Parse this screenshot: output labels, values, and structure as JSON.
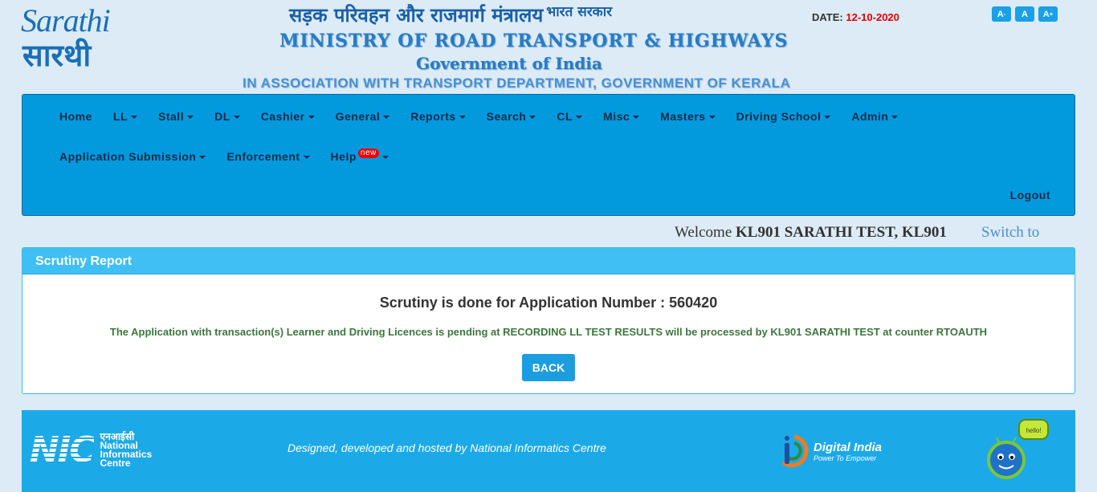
{
  "header": {
    "logo_top": "Sarathi",
    "logo_bottom": "सारथी",
    "hindi_title": "सड़क परिवहन और राजमार्ग मंत्रालय",
    "hindi_sub": "भारत सरकार",
    "title_en": "MINISTRY OF ROAD TRANSPORT & HIGHWAYS",
    "goi": "Government of India",
    "association": "IN ASSOCIATION WITH TRANSPORT DEPARTMENT, GOVERNMENT OF KERALA",
    "date_label": "DATE:",
    "date_value": "12-10-2020",
    "font_buttons": [
      "A",
      "A",
      "A"
    ]
  },
  "nav": {
    "row1": [
      "Home",
      "LL",
      "Stall",
      "DL",
      "Cashier",
      "General",
      "Reports",
      "Search",
      "CL",
      "Misc",
      "Masters",
      "Driving School",
      "Admin"
    ],
    "row2": [
      "Application Submission",
      "Enforcement",
      "Help"
    ],
    "new_badge": "new",
    "logout": "Logout"
  },
  "welcome": {
    "prefix": "Welcome",
    "user": "KL901 SARATHI TEST, KL901",
    "switch": "Switch to"
  },
  "panel": {
    "title": "Scrutiny Report",
    "heading": "Scrutiny is done for Application Number : 560420",
    "message": "The Application with transaction(s) Learner and Driving Licences is pending at RECORDING LL TEST RESULTS will be processed by KL901 SARATHI TEST at counter RTOAUTH",
    "back_label": "BACK"
  },
  "footer": {
    "nic_logo": "NIC",
    "nic_hindi": "एनआईसी",
    "nic_line1": "National",
    "nic_line2": "Informatics",
    "nic_line3": "Centre",
    "designed": "Designed, developed and hosted by National Informatics Centre",
    "di_title": "Digital India",
    "di_tag": "Power To Empower",
    "mascot_text": "hello!"
  },
  "colors": {
    "nav_bg": "#0399dd",
    "panel_head": "#40bff5",
    "footer_bg": "#1ca9e8",
    "date_red": "#e00000",
    "success_green": "#3c763d"
  }
}
